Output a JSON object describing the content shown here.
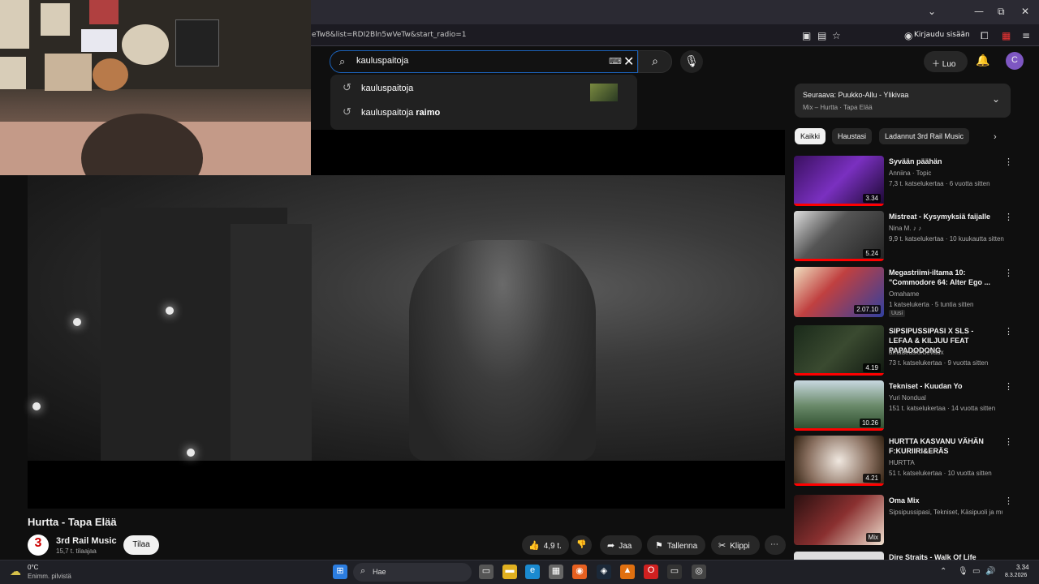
{
  "browser": {
    "url": "eTw8&list=RDI2Bln5wVeTw&start_radio=1",
    "signin_label": "Kirjaudu sisään"
  },
  "search": {
    "query": "kauluspaitoja",
    "suggestions": [
      {
        "prefix": "kauluspaitoja",
        "bold": ""
      },
      {
        "prefix": "kauluspaitoja ",
        "bold": "raimo"
      }
    ]
  },
  "masthead": {
    "create_label": "Luo",
    "avatar_letter": "C"
  },
  "video": {
    "title": "Hurtta - Tapa Elää",
    "channel": "3rd Rail Music",
    "subscribers": "15,7 t. tilaajaa",
    "subscribe_label": "Tilaa",
    "likes": "4,9 t.",
    "share_label": "Jaa",
    "save_label": "Tallenna",
    "clip_label": "Klippi"
  },
  "up_next": {
    "title": "Seuraava: Puukko-Allu - Ylikivaa",
    "subtitle": "Mix – Hurtta · Tapa Elää"
  },
  "chips": [
    "Kaikki",
    "Haustasi",
    "Ladannut 3rd Rail Music"
  ],
  "recommendations": [
    {
      "title": "Syvään päähän",
      "channel": "Anniina · Topic",
      "stats": "7,3 t. katselukertaa · 6 vuotta sitten",
      "duration": "3.34"
    },
    {
      "title": "Mistreat - Kysymyksiä faijalle",
      "channel": "Nina M. ♪ ♪",
      "stats": "9,9 t. katselukertaa · 10 kuukautta sitten",
      "duration": "5.24"
    },
    {
      "title": "Megastriimi-iltama 10: \"Commodore 64: Alter Ego ...",
      "channel": "Omahame",
      "stats": "1 katselukerta · 5 tuntia sitten",
      "duration": "2.07.10",
      "badge": "Uusi"
    },
    {
      "title": "SIPSIPUSSIPASI X SLS - LEFAA & KILJUU FEAT PAPADODONG",
      "channel": "amadeuslordevaux",
      "stats": "73 t. katselukertaa · 9 vuotta sitten",
      "duration": "4.19"
    },
    {
      "title": "Tekniset - Kuudan Yo",
      "channel": "Yuri Nondual",
      "stats": "151 t. katselukertaa · 14 vuotta sitten",
      "duration": "10.26"
    },
    {
      "title": "HURTTA KASVANU VÄHÄN F:KURIIRI&ERÄS",
      "channel": "HURTTA",
      "stats": "51 t. katselukertaa · 10 vuotta sitten",
      "duration": "4.21"
    },
    {
      "title": "Oma Mix",
      "channel": "Sipsipussipasi, Tekniset, Käsipuoli ja mui...",
      "stats": "",
      "duration": "Mix"
    },
    {
      "title": "Dire Straits - Walk Of Life",
      "channel": "",
      "stats": "",
      "duration": ""
    }
  ],
  "taskbar": {
    "temp": "0°C",
    "weather": "Enimm. pilvistä",
    "search_label": "Hae",
    "time": "3.34",
    "date": "8.3.2026"
  }
}
